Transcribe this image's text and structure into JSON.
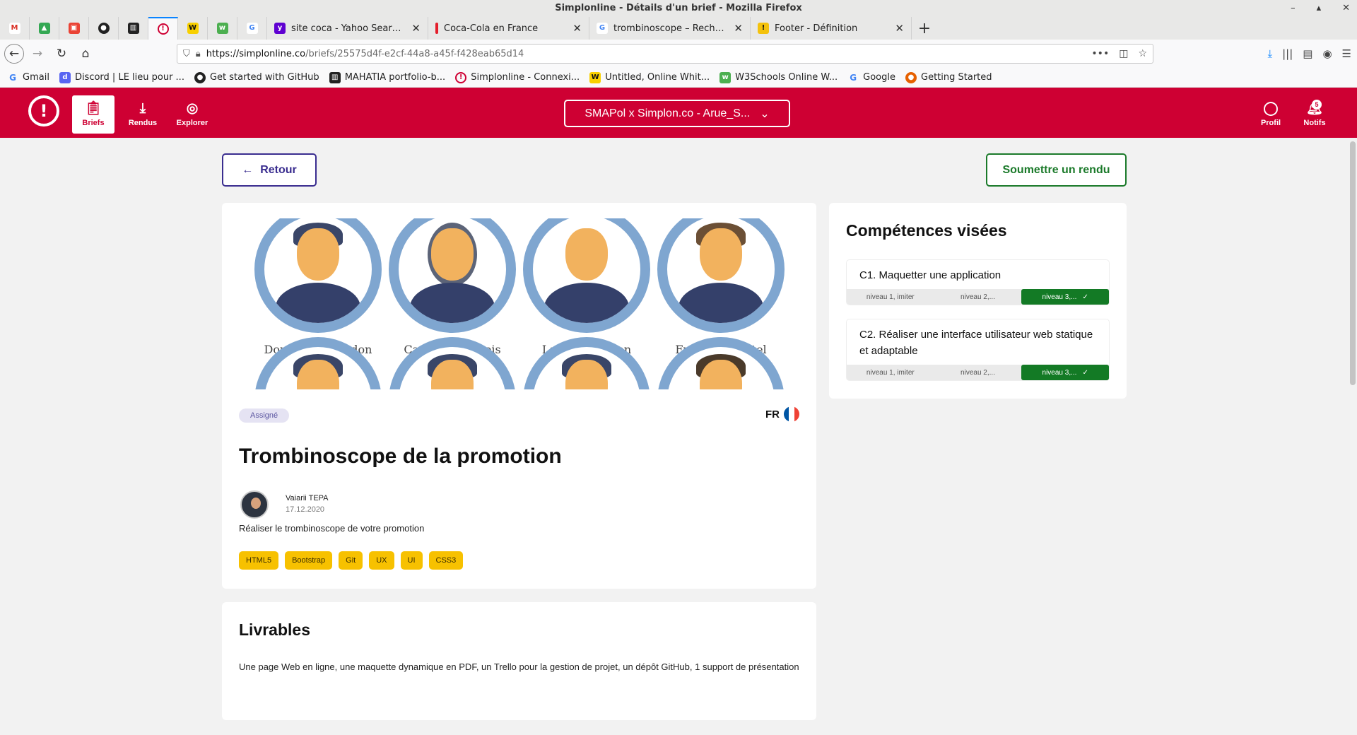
{
  "window_title": "Simplonline - Détails d'un brief - Mozilla Firefox",
  "tabs": [
    {
      "title": "site coca - Yahoo Search - A",
      "favicon_color": "#5f01d1"
    },
    {
      "title": "Coca-Cola en France",
      "favicon_color": "#e41e2b"
    },
    {
      "title": "trombinoscope – Recherche",
      "favicon_color": "#4285f4"
    },
    {
      "title": "Footer - Définition",
      "favicon_color": "#f4c20d"
    }
  ],
  "url": {
    "host": "https://simplonline.co",
    "path": "/briefs/25575d4f-e2cf-44a8-a45f-f428eab65d14"
  },
  "bookmarks": [
    "Gmail",
    "Discord | LE lieu pour ...",
    "Get started with GitHub",
    "MAHATIA portfolio-b...",
    "Simplonline - Connexi...",
    "Untitled, Online Whit...",
    "W3Schools Online W...",
    "Google",
    "Getting Started"
  ],
  "app": {
    "nav": {
      "briefs": "Briefs",
      "rendus": "Rendus",
      "explorer": "Explorer",
      "profil": "Profil",
      "notifs": "Notifs"
    },
    "notif_count": "5",
    "promo_select": "SMAPol x Simplon.co - Arue_S..."
  },
  "actions": {
    "back": "Retour",
    "submit": "Soumettre un rendu"
  },
  "brief": {
    "portraits": [
      "Dominique Cardon",
      "Camille François",
      "Laurent Le Bon",
      "Frédéric Martel"
    ],
    "status": "Assigné",
    "lang": "FR",
    "title": "Trombinoscope de la promotion",
    "author": "Vaiarii TEPA",
    "date": "17.12.2020",
    "description": "Réaliser le trombinoscope de votre promotion",
    "tags": [
      "HTML5",
      "Bootstrap",
      "Git",
      "UX",
      "UI",
      "CSS3"
    ]
  },
  "livrables": {
    "title": "Livrables",
    "text": "Une page Web en ligne, une maquette dynamique en PDF, un Trello pour la gestion de projet, un dépôt GitHub, 1 support de présentation"
  },
  "competences": {
    "title": "Compétences visées",
    "items": [
      {
        "label": "C1. Maquetter une application",
        "levels": [
          "niveau 1, imiter",
          "niveau 2,...",
          "niveau 3,..."
        ]
      },
      {
        "label": "C2. Réaliser une interface utilisateur web statique et adaptable",
        "levels": [
          "niveau 1, imiter",
          "niveau 2,...",
          "niveau 3,..."
        ]
      }
    ]
  },
  "colors": {
    "brand": "#ce0033",
    "success": "#137a25",
    "accent_purple": "#3a2d8f",
    "tag_yellow": "#f7c100"
  }
}
